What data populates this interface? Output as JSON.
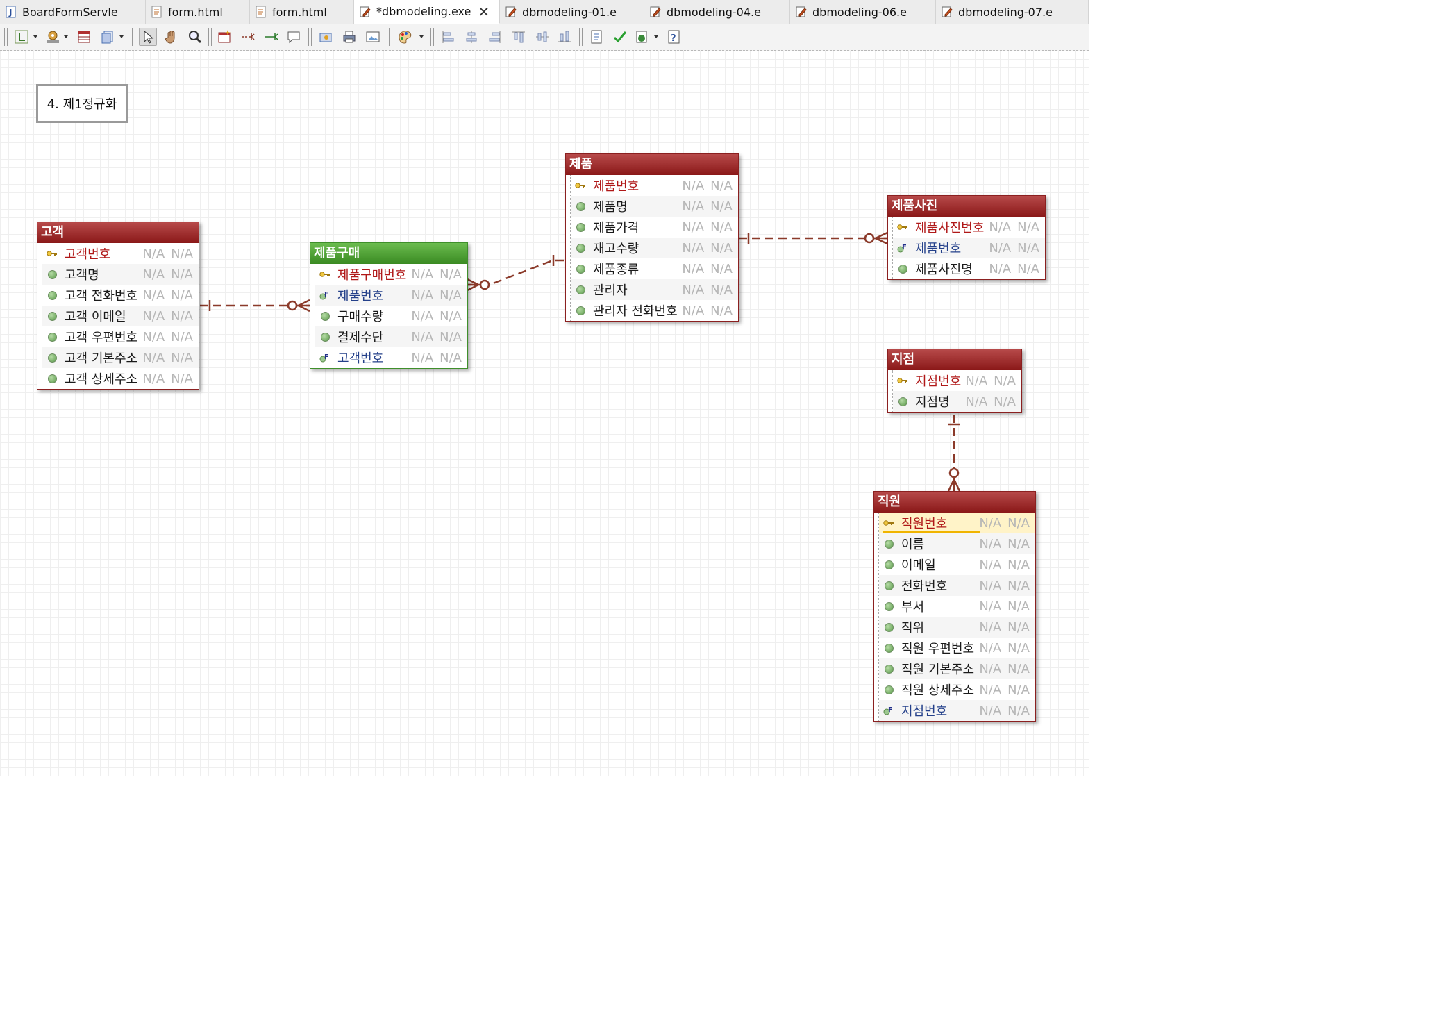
{
  "tabs": [
    {
      "label": "BoardFormServle",
      "icon": "java-file-icon",
      "active": false
    },
    {
      "label": "form.html",
      "icon": "html-file-icon",
      "active": false
    },
    {
      "label": "form.html",
      "icon": "html-file-icon",
      "active": false
    },
    {
      "label": "*dbmodeling.exe",
      "icon": "erd-file-icon",
      "active": true,
      "close": "✕"
    },
    {
      "label": "dbmodeling-01.e",
      "icon": "erd-file-icon",
      "active": false
    },
    {
      "label": "dbmodeling-04.e",
      "icon": "erd-file-icon",
      "active": false
    },
    {
      "label": "dbmodeling-06.e",
      "icon": "erd-file-icon",
      "active": false
    },
    {
      "label": "dbmodeling-07.e",
      "icon": "erd-file-icon",
      "active": false
    }
  ],
  "toolbar": {
    "icons": [
      "layout-icon",
      "settings-icon",
      "table-icon",
      "copy-icon",
      "select-arrow-icon",
      "hand-icon",
      "zoom-icon",
      "new-table-icon",
      "relation-dashed-icon",
      "relation-solid-icon",
      "note-icon",
      "export-image-icon",
      "print-icon",
      "image-icon",
      "color-palette-icon",
      "align-left-icon",
      "align-center-icon",
      "align-right-icon",
      "align-top-icon",
      "align-middle-icon",
      "align-bottom-icon",
      "properties-icon",
      "validate-icon",
      "generate-icon",
      "help-icon"
    ]
  },
  "note": {
    "text": "4. 제1정규화"
  },
  "na_label": "N/A",
  "colors": {
    "entity_red": "#8b2020",
    "entity_green": "#3f8f2b",
    "relation_line": "#8b3a2a"
  },
  "entities": {
    "customer": {
      "title": "고객",
      "rows": [
        {
          "name": "고객번호",
          "kind": "pk",
          "type": "N/A",
          "extra": "N/A"
        },
        {
          "name": "고객명",
          "kind": "attr",
          "type": "N/A",
          "extra": "N/A"
        },
        {
          "name": "고객 전화번호",
          "kind": "attr",
          "type": "N/A",
          "extra": "N/A"
        },
        {
          "name": "고객 이메일",
          "kind": "attr",
          "type": "N/A",
          "extra": "N/A"
        },
        {
          "name": "고객 우편번호",
          "kind": "attr",
          "type": "N/A",
          "extra": "N/A"
        },
        {
          "name": "고객 기본주소",
          "kind": "attr",
          "type": "N/A",
          "extra": "N/A"
        },
        {
          "name": "고객 상세주소",
          "kind": "attr",
          "type": "N/A",
          "extra": "N/A"
        }
      ]
    },
    "purchase": {
      "title": "제품구매",
      "rows": [
        {
          "name": "제품구매번호",
          "kind": "pk",
          "type": "N/A",
          "extra": "N/A"
        },
        {
          "name": "제품번호",
          "kind": "fk",
          "type": "N/A",
          "extra": "N/A"
        },
        {
          "name": "구매수량",
          "kind": "attr",
          "type": "N/A",
          "extra": "N/A"
        },
        {
          "name": "결제수단",
          "kind": "attr",
          "type": "N/A",
          "extra": "N/A"
        },
        {
          "name": "고객번호",
          "kind": "fk",
          "type": "N/A",
          "extra": "N/A"
        }
      ]
    },
    "product": {
      "title": "제품",
      "rows": [
        {
          "name": "제품번호",
          "kind": "pk",
          "type": "N/A",
          "extra": "N/A"
        },
        {
          "name": "제품명",
          "kind": "attr",
          "type": "N/A",
          "extra": "N/A"
        },
        {
          "name": "제품가격",
          "kind": "attr",
          "type": "N/A",
          "extra": "N/A"
        },
        {
          "name": "재고수량",
          "kind": "attr",
          "type": "N/A",
          "extra": "N/A"
        },
        {
          "name": "제품종류",
          "kind": "attr",
          "type": "N/A",
          "extra": "N/A"
        },
        {
          "name": "관리자",
          "kind": "attr",
          "type": "N/A",
          "extra": "N/A"
        },
        {
          "name": "관리자 전화번호",
          "kind": "attr",
          "type": "N/A",
          "extra": "N/A"
        }
      ]
    },
    "product_photo": {
      "title": "제품사진",
      "rows": [
        {
          "name": "제품사진번호",
          "kind": "pk",
          "type": "N/A",
          "extra": "N/A"
        },
        {
          "name": "제품번호",
          "kind": "fk",
          "type": "N/A",
          "extra": "N/A"
        },
        {
          "name": "제품사진명",
          "kind": "attr",
          "type": "N/A",
          "extra": "N/A"
        }
      ]
    },
    "branch": {
      "title": "지점",
      "rows": [
        {
          "name": "지점번호",
          "kind": "pk",
          "type": "N/A",
          "extra": "N/A"
        },
        {
          "name": "지점명",
          "kind": "attr",
          "type": "N/A",
          "extra": "N/A"
        }
      ]
    },
    "employee": {
      "title": "직원",
      "rows": [
        {
          "name": "직원번호",
          "kind": "pk",
          "type": "N/A",
          "extra": "N/A",
          "selected": true
        },
        {
          "name": "이름",
          "kind": "attr",
          "type": "N/A",
          "extra": "N/A"
        },
        {
          "name": "이메일",
          "kind": "attr",
          "type": "N/A",
          "extra": "N/A"
        },
        {
          "name": "전화번호",
          "kind": "attr",
          "type": "N/A",
          "extra": "N/A"
        },
        {
          "name": "부서",
          "kind": "attr",
          "type": "N/A",
          "extra": "N/A"
        },
        {
          "name": "직위",
          "kind": "attr",
          "type": "N/A",
          "extra": "N/A"
        },
        {
          "name": "직원 우편번호",
          "kind": "attr",
          "type": "N/A",
          "extra": "N/A"
        },
        {
          "name": "직원 기본주소",
          "kind": "attr",
          "type": "N/A",
          "extra": "N/A"
        },
        {
          "name": "직원 상세주소",
          "kind": "attr",
          "type": "N/A",
          "extra": "N/A"
        },
        {
          "name": "지점번호",
          "kind": "fk",
          "type": "N/A",
          "extra": "N/A"
        }
      ]
    }
  }
}
